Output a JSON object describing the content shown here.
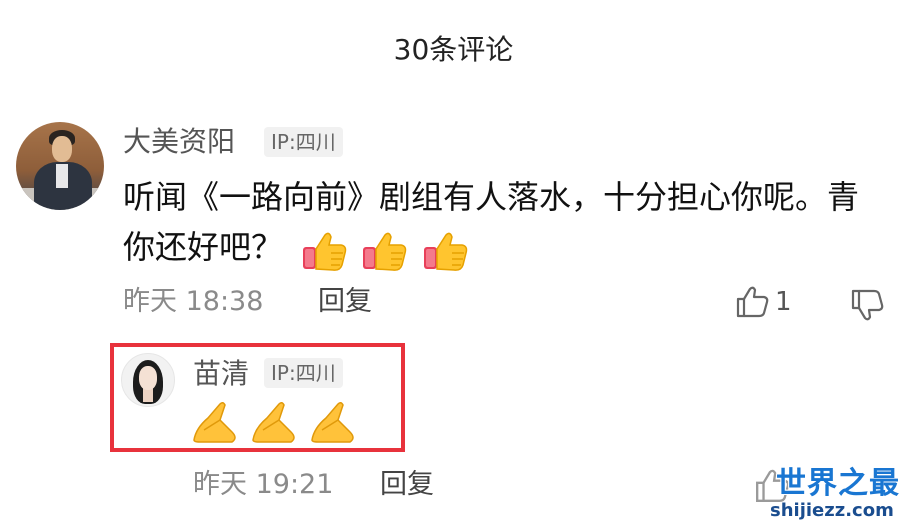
{
  "header": {
    "title": "30条评论"
  },
  "comment": {
    "username": "大美资阳",
    "ip": "IP:四川",
    "text": "听闻《一路向前》剧组有人落水，十分担心你呢。青你还好吧？",
    "emojis": [
      "thumbs-up-emoji",
      "thumbs-up-emoji",
      "thumbs-up-emoji"
    ],
    "time": "昨天 18:38",
    "reply_label": "回复",
    "like_count": "1",
    "colors": {
      "username": "#555555",
      "time": "#8a8a8a"
    }
  },
  "reply": {
    "username": "苗清",
    "ip": "IP:四川",
    "emojis": [
      "folded-hands-emoji",
      "folded-hands-emoji",
      "folded-hands-emoji"
    ],
    "time": "昨天 19:21",
    "reply_label": "回复",
    "highlight_color": "#e8323c"
  },
  "watermark": {
    "title": "世界之最",
    "url": "shijiezz.com",
    "color": "#1976d2"
  }
}
